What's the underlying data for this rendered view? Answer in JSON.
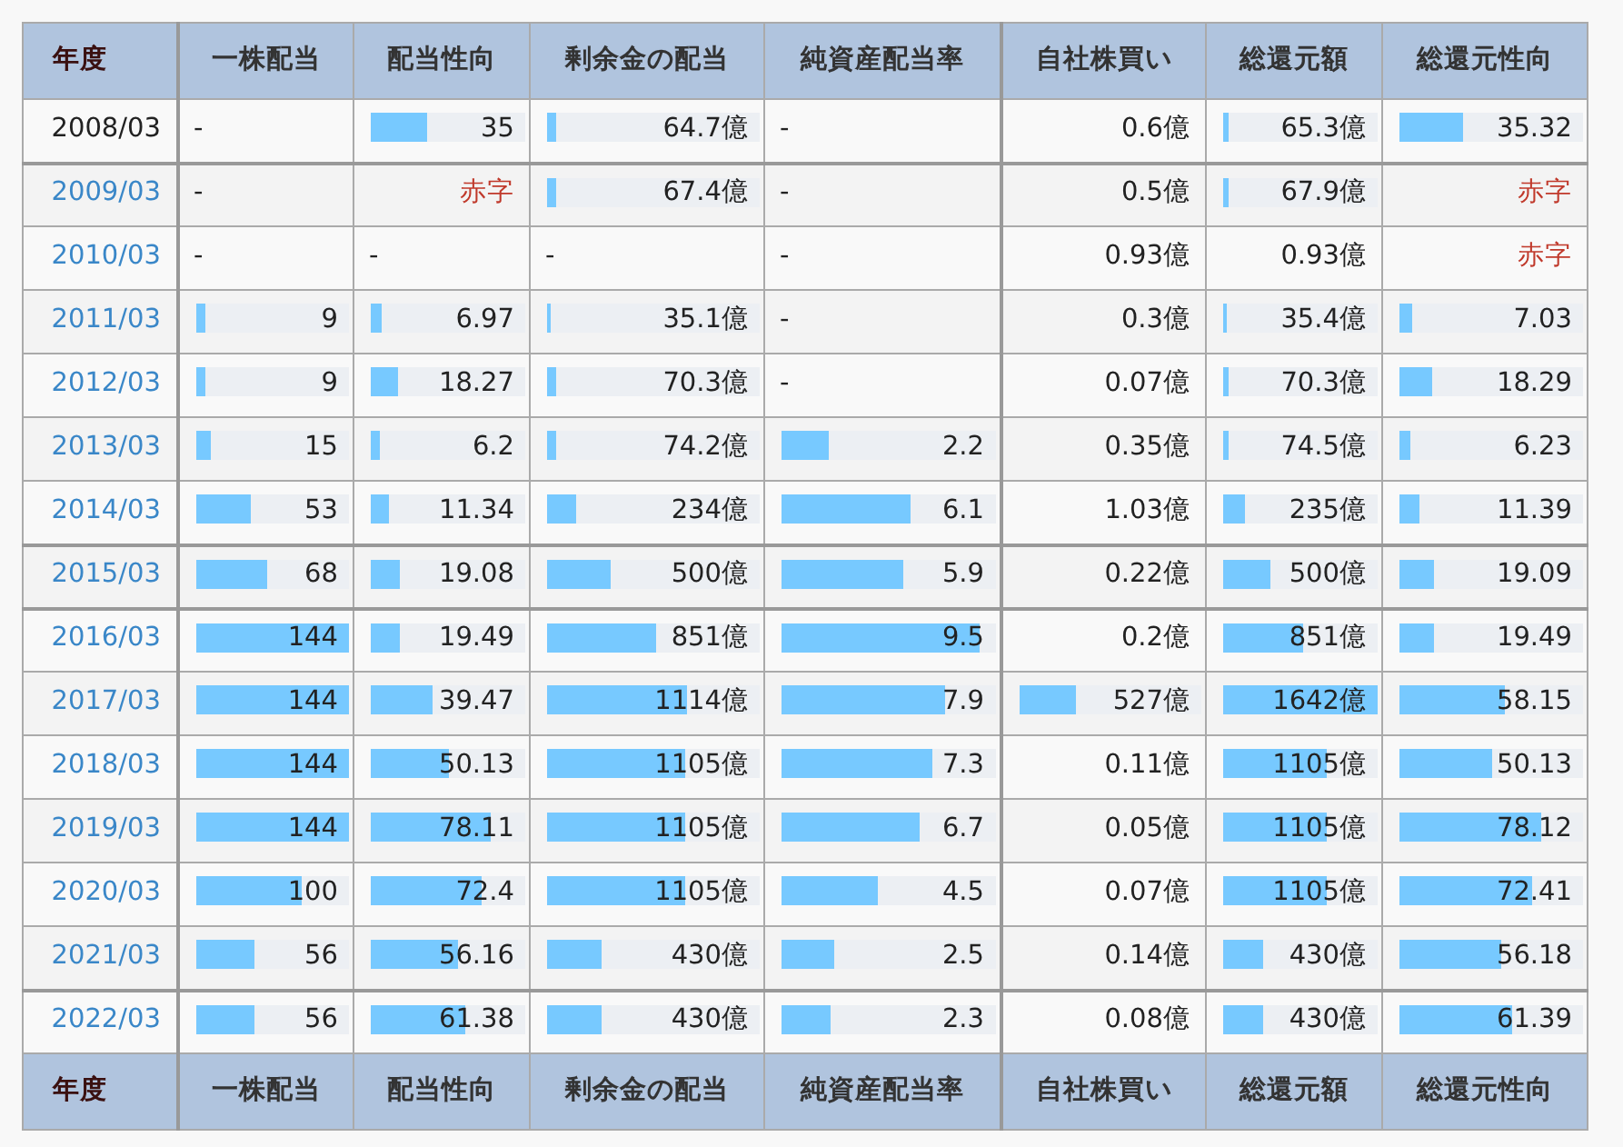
{
  "columns": [
    {
      "text": "年度",
      "rule_after": true
    },
    {
      "text": "一株配当",
      "rule_after": false
    },
    {
      "text": "配当性向",
      "rule_after": false
    },
    {
      "text": "剰余金の配当",
      "rule_after": false
    },
    {
      "text": "純資産配当率",
      "rule_after": true
    },
    {
      "text": "自社株買い",
      "rule_after": false
    },
    {
      "text": "総還元額",
      "rule_after": false
    },
    {
      "text": "総還元性向",
      "rule_after": false
    }
  ],
  "rows": [
    {
      "year": "2008/03",
      "link": false,
      "rule_below": true,
      "cells": [
        {
          "kind": "dash",
          "text": "-"
        },
        {
          "kind": "value",
          "text": "35",
          "level": 0.36
        },
        {
          "kind": "value",
          "text": "64.7億",
          "level": 0.04
        },
        {
          "kind": "dash",
          "text": "-"
        },
        {
          "kind": "value",
          "text": "0.6億"
        },
        {
          "kind": "value",
          "text": "65.3億",
          "level": 0.04
        },
        {
          "kind": "value",
          "text": "35.32",
          "level": 0.35
        }
      ]
    },
    {
      "year": "2009/03",
      "link": true,
      "rule_below": false,
      "cells": [
        {
          "kind": "dash",
          "text": "-"
        },
        {
          "kind": "deficit",
          "text": "赤字"
        },
        {
          "kind": "value",
          "text": "67.4億",
          "level": 0.04
        },
        {
          "kind": "dash",
          "text": "-"
        },
        {
          "kind": "value",
          "text": "0.5億"
        },
        {
          "kind": "value",
          "text": "67.9億",
          "level": 0.04
        },
        {
          "kind": "deficit",
          "text": "赤字"
        }
      ]
    },
    {
      "year": "2010/03",
      "link": true,
      "rule_below": false,
      "cells": [
        {
          "kind": "dash",
          "text": "-"
        },
        {
          "kind": "dash",
          "text": "-"
        },
        {
          "kind": "dash",
          "text": "-"
        },
        {
          "kind": "dash",
          "text": "-"
        },
        {
          "kind": "value",
          "text": "0.93億"
        },
        {
          "kind": "value",
          "text": "0.93億"
        },
        {
          "kind": "deficit",
          "text": "赤字"
        }
      ]
    },
    {
      "year": "2011/03",
      "link": true,
      "rule_below": false,
      "cells": [
        {
          "kind": "value",
          "text": "9",
          "level": 0.06
        },
        {
          "kind": "value",
          "text": "6.97",
          "level": 0.07
        },
        {
          "kind": "value",
          "text": "35.1億",
          "level": 0.02
        },
        {
          "kind": "dash",
          "text": "-"
        },
        {
          "kind": "value",
          "text": "0.3億"
        },
        {
          "kind": "value",
          "text": "35.4億",
          "level": 0.02
        },
        {
          "kind": "value",
          "text": "7.03",
          "level": 0.07
        }
      ]
    },
    {
      "year": "2012/03",
      "link": true,
      "rule_below": false,
      "cells": [
        {
          "kind": "value",
          "text": "9",
          "level": 0.06
        },
        {
          "kind": "value",
          "text": "18.27",
          "level": 0.18
        },
        {
          "kind": "value",
          "text": "70.3億",
          "level": 0.04
        },
        {
          "kind": "dash",
          "text": "-"
        },
        {
          "kind": "value",
          "text": "0.07億"
        },
        {
          "kind": "value",
          "text": "70.3億",
          "level": 0.04
        },
        {
          "kind": "value",
          "text": "18.29",
          "level": 0.18
        }
      ]
    },
    {
      "year": "2013/03",
      "link": true,
      "rule_below": false,
      "cells": [
        {
          "kind": "value",
          "text": "15",
          "level": 0.1
        },
        {
          "kind": "value",
          "text": "6.2",
          "level": 0.06
        },
        {
          "kind": "value",
          "text": "74.2億",
          "level": 0.04
        },
        {
          "kind": "value",
          "text": "2.2",
          "level": 0.22
        },
        {
          "kind": "value",
          "text": "0.35億"
        },
        {
          "kind": "value",
          "text": "74.5億",
          "level": 0.04
        },
        {
          "kind": "value",
          "text": "6.23",
          "level": 0.06
        }
      ]
    },
    {
      "year": "2014/03",
      "link": true,
      "rule_below": true,
      "cells": [
        {
          "kind": "value",
          "text": "53",
          "level": 0.36
        },
        {
          "kind": "value",
          "text": "11.34",
          "level": 0.12
        },
        {
          "kind": "value",
          "text": "234億",
          "level": 0.14
        },
        {
          "kind": "value",
          "text": "6.1",
          "level": 0.6
        },
        {
          "kind": "value",
          "text": "1.03億"
        },
        {
          "kind": "value",
          "text": "235億",
          "level": 0.14
        },
        {
          "kind": "value",
          "text": "11.39",
          "level": 0.11
        }
      ]
    },
    {
      "year": "2015/03",
      "link": true,
      "rule_below": true,
      "cells": [
        {
          "kind": "value",
          "text": "68",
          "level": 0.47
        },
        {
          "kind": "value",
          "text": "19.08",
          "level": 0.19
        },
        {
          "kind": "value",
          "text": "500億",
          "level": 0.3
        },
        {
          "kind": "value",
          "text": "5.9",
          "level": 0.57
        },
        {
          "kind": "value",
          "text": "0.22億"
        },
        {
          "kind": "value",
          "text": "500億",
          "level": 0.3
        },
        {
          "kind": "value",
          "text": "19.09",
          "level": 0.19
        }
      ]
    },
    {
      "year": "2016/03",
      "link": true,
      "rule_below": false,
      "cells": [
        {
          "kind": "value",
          "text": "144",
          "level": 1
        },
        {
          "kind": "value",
          "text": "19.49",
          "level": 0.19
        },
        {
          "kind": "value",
          "text": "851億",
          "level": 0.51
        },
        {
          "kind": "value",
          "text": "9.5",
          "level": 0.93
        },
        {
          "kind": "value",
          "text": "0.2億"
        },
        {
          "kind": "value",
          "text": "851億",
          "level": 0.52
        },
        {
          "kind": "value",
          "text": "19.49",
          "level": 0.19
        }
      ]
    },
    {
      "year": "2017/03",
      "link": true,
      "rule_below": false,
      "cells": [
        {
          "kind": "value",
          "text": "144",
          "level": 1
        },
        {
          "kind": "value",
          "text": "39.47",
          "level": 0.4
        },
        {
          "kind": "value",
          "text": "1114億",
          "level": 0.66
        },
        {
          "kind": "value",
          "text": "7.9",
          "level": 0.77
        },
        {
          "kind": "value",
          "text": "527億",
          "level": 0.31
        },
        {
          "kind": "value",
          "text": "1642億",
          "level": 1
        },
        {
          "kind": "value",
          "text": "58.15",
          "level": 0.57
        }
      ]
    },
    {
      "year": "2018/03",
      "link": true,
      "rule_below": false,
      "cells": [
        {
          "kind": "value",
          "text": "144",
          "level": 1
        },
        {
          "kind": "value",
          "text": "50.13",
          "level": 0.5
        },
        {
          "kind": "value",
          "text": "1105億",
          "level": 0.65
        },
        {
          "kind": "value",
          "text": "7.3",
          "level": 0.71
        },
        {
          "kind": "value",
          "text": "0.11億"
        },
        {
          "kind": "value",
          "text": "1105億",
          "level": 0.67
        },
        {
          "kind": "value",
          "text": "50.13",
          "level": 0.5
        }
      ]
    },
    {
      "year": "2019/03",
      "link": true,
      "rule_below": false,
      "cells": [
        {
          "kind": "value",
          "text": "144",
          "level": 1
        },
        {
          "kind": "value",
          "text": "78.11",
          "level": 0.78
        },
        {
          "kind": "value",
          "text": "1105億",
          "level": 0.65
        },
        {
          "kind": "value",
          "text": "6.7",
          "level": 0.65
        },
        {
          "kind": "value",
          "text": "0.05億"
        },
        {
          "kind": "value",
          "text": "1105億",
          "level": 0.67
        },
        {
          "kind": "value",
          "text": "78.12",
          "level": 0.77
        }
      ]
    },
    {
      "year": "2020/03",
      "link": true,
      "rule_below": false,
      "cells": [
        {
          "kind": "value",
          "text": "100",
          "level": 0.69
        },
        {
          "kind": "value",
          "text": "72.4",
          "level": 0.72
        },
        {
          "kind": "value",
          "text": "1105億",
          "level": 0.65
        },
        {
          "kind": "value",
          "text": "4.5",
          "level": 0.45
        },
        {
          "kind": "value",
          "text": "0.07億"
        },
        {
          "kind": "value",
          "text": "1105億",
          "level": 0.67
        },
        {
          "kind": "value",
          "text": "72.41",
          "level": 0.72
        }
      ]
    },
    {
      "year": "2021/03",
      "link": true,
      "rule_below": true,
      "cells": [
        {
          "kind": "value",
          "text": "56",
          "level": 0.38
        },
        {
          "kind": "value",
          "text": "56.16",
          "level": 0.56
        },
        {
          "kind": "value",
          "text": "430億",
          "level": 0.26
        },
        {
          "kind": "value",
          "text": "2.5",
          "level": 0.25
        },
        {
          "kind": "value",
          "text": "0.14億"
        },
        {
          "kind": "value",
          "text": "430億",
          "level": 0.26
        },
        {
          "kind": "value",
          "text": "56.18",
          "level": 0.55
        }
      ]
    },
    {
      "year": "2022/03",
      "link": true,
      "rule_below": false,
      "cells": [
        {
          "kind": "value",
          "text": "56",
          "level": 0.38
        },
        {
          "kind": "value",
          "text": "61.38",
          "level": 0.61
        },
        {
          "kind": "value",
          "text": "430億",
          "level": 0.26
        },
        {
          "kind": "value",
          "text": "2.3",
          "level": 0.23
        },
        {
          "kind": "value",
          "text": "0.08億"
        },
        {
          "kind": "value",
          "text": "430億",
          "level": 0.26
        },
        {
          "kind": "value",
          "text": "61.39",
          "level": 0.61
        }
      ]
    }
  ],
  "footer": [
    {
      "text": "年度",
      "rule_after": true
    },
    {
      "text": "一株配当",
      "rule_after": false
    },
    {
      "text": "配当性向",
      "rule_after": false
    },
    {
      "text": "剰余金の配当",
      "rule_after": false
    },
    {
      "text": "純資産配当率",
      "rule_after": true
    },
    {
      "text": "自社株買い",
      "rule_after": false
    },
    {
      "text": "総還元額",
      "rule_after": false
    },
    {
      "text": "総還元性向",
      "rule_after": false
    }
  ]
}
